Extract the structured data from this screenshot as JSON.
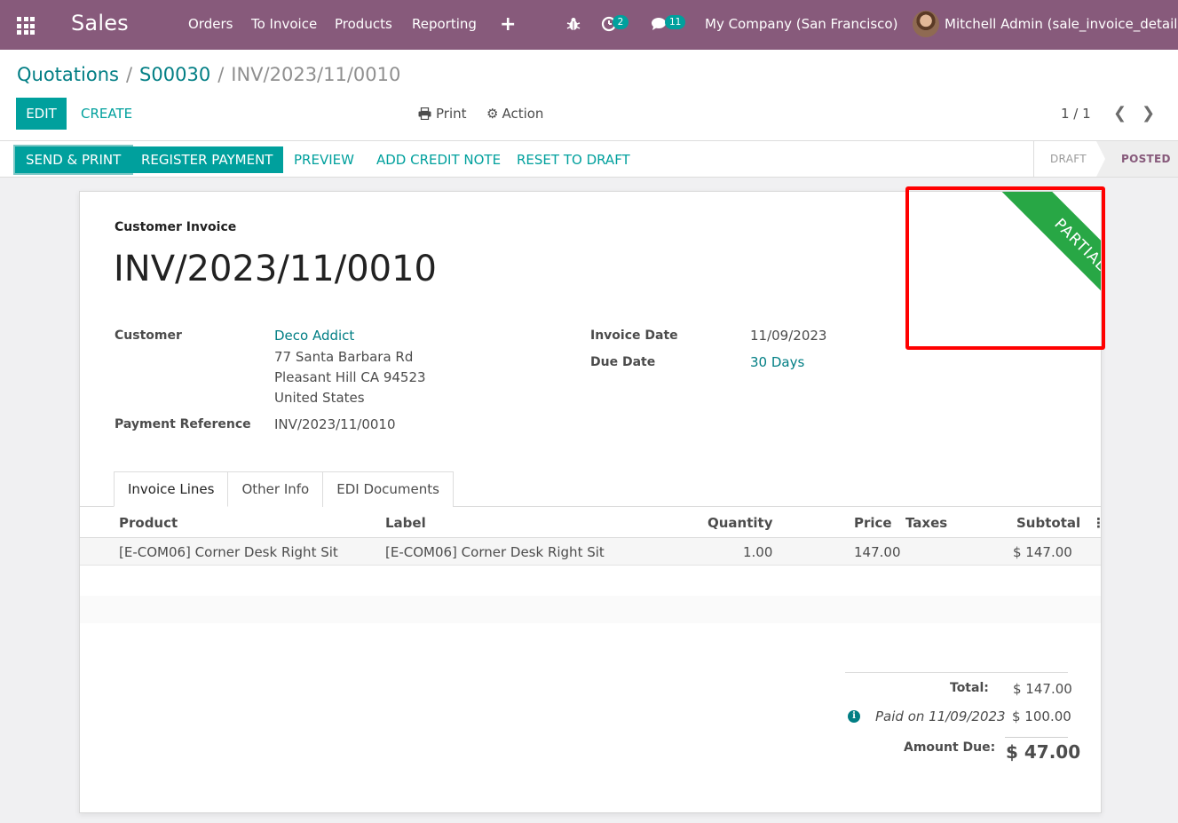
{
  "navbar": {
    "brand": "Sales",
    "menu": [
      "Orders",
      "To Invoice",
      "Products",
      "Reporting"
    ],
    "activities_count": "2",
    "messages_count": "11",
    "company": "My Company (San Francisco)",
    "user": "Mitchell Admin (sale_invoice_detail)"
  },
  "breadcrumb": {
    "items": [
      "Quotations",
      "S00030"
    ],
    "current": "INV/2023/11/0010"
  },
  "toolbar": {
    "edit_label": "EDIT",
    "create_label": "CREATE",
    "print_label": "Print",
    "action_label": "Action",
    "pager": "1 / 1"
  },
  "statusbar": {
    "buttons": [
      "SEND & PRINT",
      "REGISTER PAYMENT",
      "PREVIEW",
      "ADD CREDIT NOTE",
      "RESET TO DRAFT"
    ],
    "stages": [
      "DRAFT",
      "POSTED"
    ],
    "active_stage": "POSTED"
  },
  "invoice": {
    "ribbon": "PARTIAL",
    "type": "Customer Invoice",
    "name": "INV/2023/11/0010",
    "customer_label": "Customer",
    "customer_name": "Deco Addict",
    "address": [
      "77 Santa Barbara Rd",
      "Pleasant Hill CA 94523",
      "United States"
    ],
    "payment_reference_label": "Payment Reference",
    "payment_reference": "INV/2023/11/0010",
    "invoice_date_label": "Invoice Date",
    "invoice_date": "11/09/2023",
    "due_date_label": "Due Date",
    "due_date": "30 Days"
  },
  "tabs": [
    "Invoice Lines",
    "Other Info",
    "EDI Documents"
  ],
  "lines": {
    "headers": [
      "Product",
      "Label",
      "Quantity",
      "Price",
      "Taxes",
      "Subtotal"
    ],
    "rows": [
      {
        "product": "[E-COM06] Corner Desk Right Sit",
        "label": "[E-COM06] Corner Desk Right Sit",
        "quantity": "1.00",
        "price": "147.00",
        "taxes": "",
        "subtotal": "$ 147.00"
      }
    ]
  },
  "totals": {
    "total_label": "Total:",
    "total": "$ 147.00",
    "paid_text": "Paid on 11/09/2023",
    "paid_amount": "$ 100.00",
    "amount_due_label": "Amount Due:",
    "amount_due": "$ 47.00"
  },
  "colors": {
    "navbar": "#875a7b",
    "primary": "#00a09d",
    "link": "#017e84",
    "ribbon": "#28a745",
    "highlight": "#ff0000"
  }
}
